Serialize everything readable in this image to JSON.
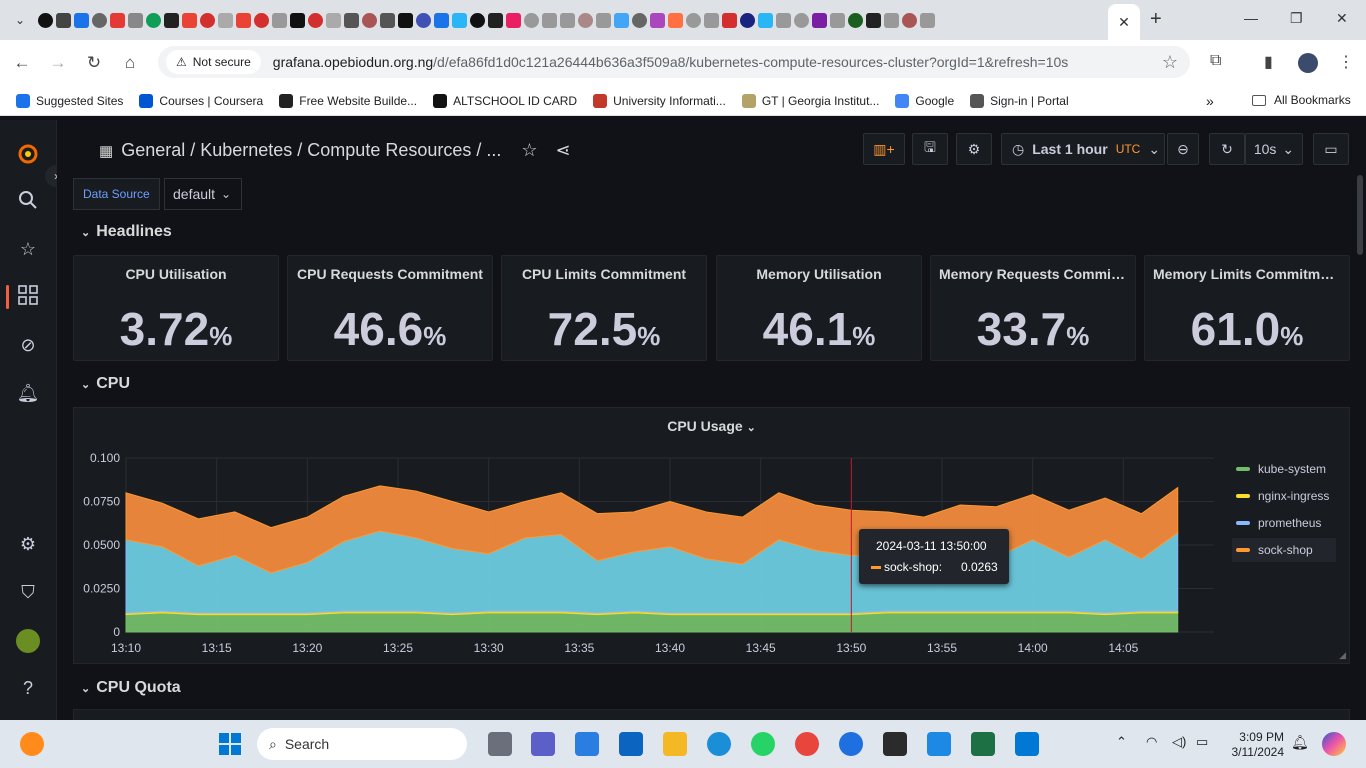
{
  "browser": {
    "active_tab_close": "✕",
    "new_tab": "+",
    "security_label": "Not secure",
    "url_host": "grafana.opebiodun.org.ng",
    "url_path": "/d/efa86fd1d0c121a26444b636a3f509a8/kubernetes-compute-resources-cluster?orgId=1&refresh=10s",
    "bookmarks": [
      {
        "label": "Suggested Sites",
        "color": "#1a73e8"
      },
      {
        "label": "Courses | Coursera",
        "color": "#0056d2"
      },
      {
        "label": "Free Website Builde...",
        "color": "#222222"
      },
      {
        "label": "ALTSCHOOL ID CARD",
        "color": "#111111"
      },
      {
        "label": "University Informati...",
        "color": "#c0392b"
      },
      {
        "label": "GT | Georgia Institut...",
        "color": "#b3a369"
      },
      {
        "label": "Google",
        "color": "#4285f4"
      },
      {
        "label": "Sign-in | Portal",
        "color": "#555555"
      }
    ],
    "all_bookmarks": "All Bookmarks",
    "more_bookmarks": "»"
  },
  "grafana": {
    "breadcrumb": "General  / Kubernetes / Compute Resources / ...",
    "data_source_label": "Data Source",
    "data_source_value": "default",
    "time_range": "Last 1 hour",
    "timezone": "UTC",
    "refresh": "10s",
    "rows": {
      "headlines": "Headlines",
      "cpu": "CPU",
      "cpu_quota": "CPU Quota"
    },
    "stats": [
      {
        "title": "CPU Utilisation",
        "value": "3.72",
        "unit": "%"
      },
      {
        "title": "CPU Requests Commitment",
        "value": "46.6",
        "unit": "%"
      },
      {
        "title": "CPU Limits Commitment",
        "value": "72.5",
        "unit": "%"
      },
      {
        "title": "Memory Utilisation",
        "value": "46.1",
        "unit": "%"
      },
      {
        "title": "Memory Requests Commitment",
        "value": "33.7",
        "unit": "%"
      },
      {
        "title": "Memory Limits Commitment",
        "value": "61.0",
        "unit": "%"
      }
    ],
    "colors": {
      "kube_system": "#73bf69",
      "nginx_ingress": "#fade2a",
      "prometheus": "#8ab8ff",
      "sock_shop": "#ff9830",
      "accent": "#f55f3e"
    },
    "tooltip": {
      "time": "2024-03-11 13:50:00",
      "series": "sock-shop:",
      "value": "0.0263"
    }
  },
  "chart_data": {
    "type": "area",
    "title": "CPU Usage",
    "stacked": true,
    "x_ticks": [
      "13:10",
      "13:15",
      "13:20",
      "13:25",
      "13:30",
      "13:35",
      "13:40",
      "13:45",
      "13:50",
      "13:55",
      "14:00",
      "14:05"
    ],
    "y_ticks": [
      "0",
      "0.0250",
      "0.0500",
      "0.0750",
      "0.100"
    ],
    "ylim": [
      0,
      0.1
    ],
    "x": [
      "13:10",
      "13:12",
      "13:14",
      "13:16",
      "13:18",
      "13:20",
      "13:22",
      "13:24",
      "13:26",
      "13:28",
      "13:30",
      "13:32",
      "13:34",
      "13:36",
      "13:38",
      "13:40",
      "13:42",
      "13:44",
      "13:46",
      "13:48",
      "13:50",
      "13:52",
      "13:54",
      "13:56",
      "13:58",
      "14:00",
      "14:02",
      "14:04",
      "14:06",
      "14:08"
    ],
    "series": [
      {
        "name": "kube-system",
        "values": [
          0.01,
          0.011,
          0.01,
          0.01,
          0.01,
          0.01,
          0.011,
          0.011,
          0.011,
          0.01,
          0.011,
          0.011,
          0.011,
          0.01,
          0.011,
          0.01,
          0.01,
          0.01,
          0.01,
          0.01,
          0.01,
          0.011,
          0.011,
          0.011,
          0.011,
          0.011,
          0.011,
          0.01,
          0.011,
          0.011
        ]
      },
      {
        "name": "nginx-ingress",
        "values": [
          0.001,
          0.001,
          0.001,
          0.001,
          0.001,
          0.001,
          0.001,
          0.001,
          0.001,
          0.001,
          0.001,
          0.001,
          0.001,
          0.001,
          0.001,
          0.001,
          0.001,
          0.001,
          0.001,
          0.001,
          0.001,
          0.001,
          0.001,
          0.001,
          0.001,
          0.001,
          0.001,
          0.001,
          0.001,
          0.001
        ]
      },
      {
        "name": "prometheus",
        "values": [
          0.042,
          0.037,
          0.027,
          0.033,
          0.023,
          0.029,
          0.04,
          0.046,
          0.042,
          0.037,
          0.033,
          0.042,
          0.044,
          0.03,
          0.034,
          0.038,
          0.031,
          0.028,
          0.042,
          0.036,
          0.033,
          0.033,
          0.029,
          0.032,
          0.031,
          0.041,
          0.031,
          0.042,
          0.03,
          0.045
        ]
      },
      {
        "name": "sock-shop",
        "values": [
          0.027,
          0.025,
          0.027,
          0.025,
          0.026,
          0.026,
          0.026,
          0.026,
          0.027,
          0.027,
          0.024,
          0.021,
          0.024,
          0.027,
          0.023,
          0.026,
          0.027,
          0.027,
          0.027,
          0.026,
          0.026,
          0.024,
          0.025,
          0.029,
          0.029,
          0.026,
          0.027,
          0.024,
          0.026,
          0.026
        ]
      }
    ]
  }
}
